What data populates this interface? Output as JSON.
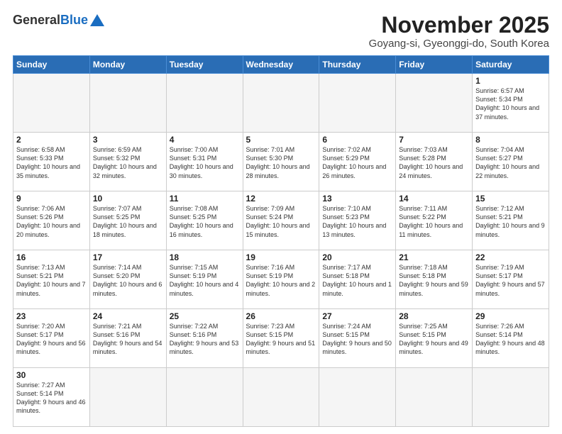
{
  "header": {
    "logo_general": "General",
    "logo_blue": "Blue",
    "month_title": "November 2025",
    "location": "Goyang-si, Gyeonggi-do, South Korea"
  },
  "weekdays": [
    "Sunday",
    "Monday",
    "Tuesday",
    "Wednesday",
    "Thursday",
    "Friday",
    "Saturday"
  ],
  "weeks": [
    [
      {
        "day": "",
        "empty": true
      },
      {
        "day": "",
        "empty": true
      },
      {
        "day": "",
        "empty": true
      },
      {
        "day": "",
        "empty": true
      },
      {
        "day": "",
        "empty": true
      },
      {
        "day": "",
        "empty": true
      },
      {
        "day": "1",
        "sunrise": "6:57 AM",
        "sunset": "5:34 PM",
        "daylight": "10 hours and 37 minutes."
      }
    ],
    [
      {
        "day": "2",
        "sunrise": "6:58 AM",
        "sunset": "5:33 PM",
        "daylight": "10 hours and 35 minutes."
      },
      {
        "day": "3",
        "sunrise": "6:59 AM",
        "sunset": "5:32 PM",
        "daylight": "10 hours and 32 minutes."
      },
      {
        "day": "4",
        "sunrise": "7:00 AM",
        "sunset": "5:31 PM",
        "daylight": "10 hours and 30 minutes."
      },
      {
        "day": "5",
        "sunrise": "7:01 AM",
        "sunset": "5:30 PM",
        "daylight": "10 hours and 28 minutes."
      },
      {
        "day": "6",
        "sunrise": "7:02 AM",
        "sunset": "5:29 PM",
        "daylight": "10 hours and 26 minutes."
      },
      {
        "day": "7",
        "sunrise": "7:03 AM",
        "sunset": "5:28 PM",
        "daylight": "10 hours and 24 minutes."
      },
      {
        "day": "8",
        "sunrise": "7:04 AM",
        "sunset": "5:27 PM",
        "daylight": "10 hours and 22 minutes."
      }
    ],
    [
      {
        "day": "9",
        "sunrise": "7:06 AM",
        "sunset": "5:26 PM",
        "daylight": "10 hours and 20 minutes."
      },
      {
        "day": "10",
        "sunrise": "7:07 AM",
        "sunset": "5:25 PM",
        "daylight": "10 hours and 18 minutes."
      },
      {
        "day": "11",
        "sunrise": "7:08 AM",
        "sunset": "5:25 PM",
        "daylight": "10 hours and 16 minutes."
      },
      {
        "day": "12",
        "sunrise": "7:09 AM",
        "sunset": "5:24 PM",
        "daylight": "10 hours and 15 minutes."
      },
      {
        "day": "13",
        "sunrise": "7:10 AM",
        "sunset": "5:23 PM",
        "daylight": "10 hours and 13 minutes."
      },
      {
        "day": "14",
        "sunrise": "7:11 AM",
        "sunset": "5:22 PM",
        "daylight": "10 hours and 11 minutes."
      },
      {
        "day": "15",
        "sunrise": "7:12 AM",
        "sunset": "5:21 PM",
        "daylight": "10 hours and 9 minutes."
      }
    ],
    [
      {
        "day": "16",
        "sunrise": "7:13 AM",
        "sunset": "5:21 PM",
        "daylight": "10 hours and 7 minutes."
      },
      {
        "day": "17",
        "sunrise": "7:14 AM",
        "sunset": "5:20 PM",
        "daylight": "10 hours and 6 minutes."
      },
      {
        "day": "18",
        "sunrise": "7:15 AM",
        "sunset": "5:19 PM",
        "daylight": "10 hours and 4 minutes."
      },
      {
        "day": "19",
        "sunrise": "7:16 AM",
        "sunset": "5:19 PM",
        "daylight": "10 hours and 2 minutes."
      },
      {
        "day": "20",
        "sunrise": "7:17 AM",
        "sunset": "5:18 PM",
        "daylight": "10 hours and 1 minute."
      },
      {
        "day": "21",
        "sunrise": "7:18 AM",
        "sunset": "5:18 PM",
        "daylight": "9 hours and 59 minutes."
      },
      {
        "day": "22",
        "sunrise": "7:19 AM",
        "sunset": "5:17 PM",
        "daylight": "9 hours and 57 minutes."
      }
    ],
    [
      {
        "day": "23",
        "sunrise": "7:20 AM",
        "sunset": "5:17 PM",
        "daylight": "9 hours and 56 minutes."
      },
      {
        "day": "24",
        "sunrise": "7:21 AM",
        "sunset": "5:16 PM",
        "daylight": "9 hours and 54 minutes."
      },
      {
        "day": "25",
        "sunrise": "7:22 AM",
        "sunset": "5:16 PM",
        "daylight": "9 hours and 53 minutes."
      },
      {
        "day": "26",
        "sunrise": "7:23 AM",
        "sunset": "5:15 PM",
        "daylight": "9 hours and 51 minutes."
      },
      {
        "day": "27",
        "sunrise": "7:24 AM",
        "sunset": "5:15 PM",
        "daylight": "9 hours and 50 minutes."
      },
      {
        "day": "28",
        "sunrise": "7:25 AM",
        "sunset": "5:15 PM",
        "daylight": "9 hours and 49 minutes."
      },
      {
        "day": "29",
        "sunrise": "7:26 AM",
        "sunset": "5:14 PM",
        "daylight": "9 hours and 48 minutes."
      }
    ],
    [
      {
        "day": "30",
        "sunrise": "7:27 AM",
        "sunset": "5:14 PM",
        "daylight": "9 hours and 46 minutes."
      },
      {
        "day": "",
        "empty": true
      },
      {
        "day": "",
        "empty": true
      },
      {
        "day": "",
        "empty": true
      },
      {
        "day": "",
        "empty": true
      },
      {
        "day": "",
        "empty": true
      },
      {
        "day": "",
        "empty": true
      }
    ]
  ]
}
